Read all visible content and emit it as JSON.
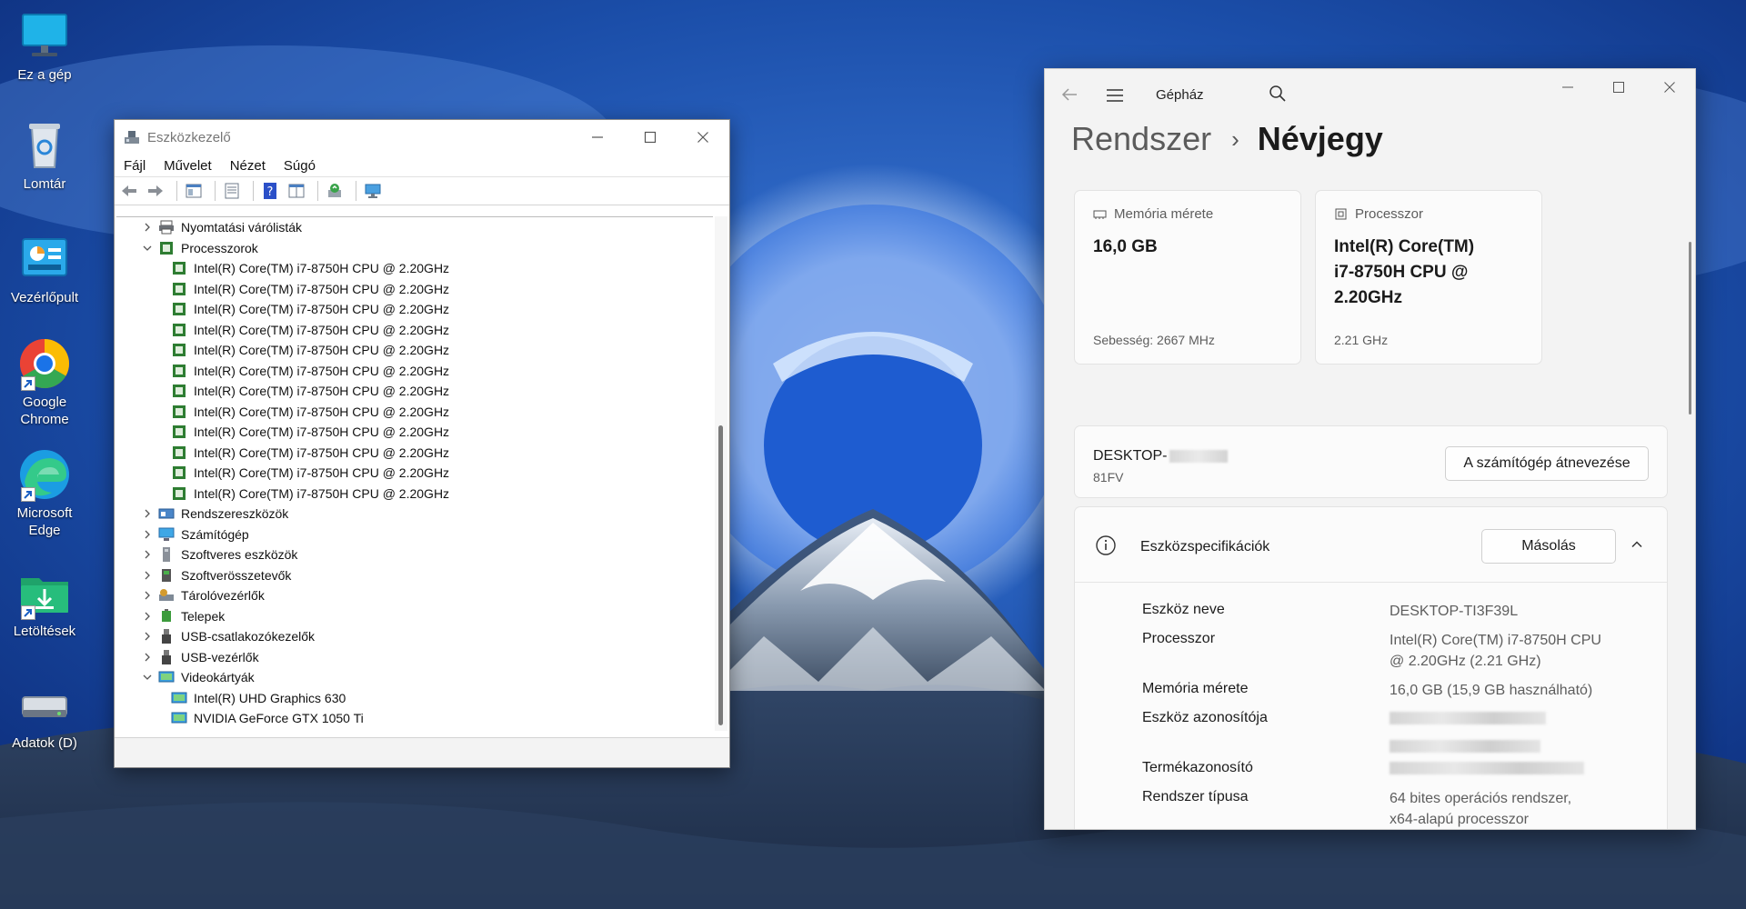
{
  "desktop": {
    "icons": [
      {
        "label": "Ez a gép"
      },
      {
        "label": "Lomtár"
      },
      {
        "label": "Vezérlőpult"
      },
      {
        "label": "Google Chrome"
      },
      {
        "label": "Microsoft Edge"
      },
      {
        "label": "Letöltések"
      },
      {
        "label": "Adatok (D)"
      }
    ]
  },
  "device_manager": {
    "title": "Eszközkezelő",
    "menu": [
      "Fájl",
      "Művelet",
      "Nézet",
      "Súgó"
    ],
    "tree": [
      {
        "label": "Nyomtatási várólisták",
        "expanded": false,
        "icon": "printer-icon"
      },
      {
        "label": "Processzorok",
        "expanded": true,
        "icon": "processor-icon"
      },
      {
        "label": "Intel(R) Core(TM) i7-8750H CPU @ 2.20GHz",
        "child": true,
        "icon": "processor-icon"
      },
      {
        "label": "Intel(R) Core(TM) i7-8750H CPU @ 2.20GHz",
        "child": true,
        "icon": "processor-icon"
      },
      {
        "label": "Intel(R) Core(TM) i7-8750H CPU @ 2.20GHz",
        "child": true,
        "icon": "processor-icon"
      },
      {
        "label": "Intel(R) Core(TM) i7-8750H CPU @ 2.20GHz",
        "child": true,
        "icon": "processor-icon"
      },
      {
        "label": "Intel(R) Core(TM) i7-8750H CPU @ 2.20GHz",
        "child": true,
        "icon": "processor-icon"
      },
      {
        "label": "Intel(R) Core(TM) i7-8750H CPU @ 2.20GHz",
        "child": true,
        "icon": "processor-icon"
      },
      {
        "label": "Intel(R) Core(TM) i7-8750H CPU @ 2.20GHz",
        "child": true,
        "icon": "processor-icon"
      },
      {
        "label": "Intel(R) Core(TM) i7-8750H CPU @ 2.20GHz",
        "child": true,
        "icon": "processor-icon"
      },
      {
        "label": "Intel(R) Core(TM) i7-8750H CPU @ 2.20GHz",
        "child": true,
        "icon": "processor-icon"
      },
      {
        "label": "Intel(R) Core(TM) i7-8750H CPU @ 2.20GHz",
        "child": true,
        "icon": "processor-icon"
      },
      {
        "label": "Intel(R) Core(TM) i7-8750H CPU @ 2.20GHz",
        "child": true,
        "icon": "processor-icon"
      },
      {
        "label": "Intel(R) Core(TM) i7-8750H CPU @ 2.20GHz",
        "child": true,
        "icon": "processor-icon"
      },
      {
        "label": "Rendszereszközök",
        "expanded": false,
        "icon": "system-devices-icon"
      },
      {
        "label": "Számítógép",
        "expanded": false,
        "icon": "computer-icon"
      },
      {
        "label": "Szoftveres eszközök",
        "expanded": false,
        "icon": "software-device-icon"
      },
      {
        "label": "Szoftverösszetevők",
        "expanded": false,
        "icon": "software-component-icon"
      },
      {
        "label": "Tárolóvezérlők",
        "expanded": false,
        "icon": "storage-controller-icon"
      },
      {
        "label": "Telepek",
        "expanded": false,
        "icon": "battery-icon"
      },
      {
        "label": "USB-csatlakozókezelők",
        "expanded": false,
        "icon": "usb-icon"
      },
      {
        "label": "USB-vezérlők",
        "expanded": false,
        "icon": "usb-icon"
      },
      {
        "label": "Videokártyák",
        "expanded": true,
        "icon": "display-adapter-icon"
      },
      {
        "label": "Intel(R) UHD Graphics 630",
        "child": true,
        "icon": "display-adapter-icon"
      },
      {
        "label": "NVIDIA GeForce GTX 1050 Ti",
        "child": true,
        "icon": "display-adapter-icon"
      }
    ]
  },
  "settings": {
    "app_title": "Gépház",
    "breadcrumb_parent": "Rendszer",
    "breadcrumb_sep": "›",
    "breadcrumb_current": "Névjegy",
    "memory_card": {
      "label": "Memória mérete",
      "value": "16,0 GB",
      "sub": "Sebesség: 2667 MHz"
    },
    "cpu_card": {
      "label": "Processzor",
      "value_lines": [
        "Intel(R) Core(TM)",
        "i7-8750H CPU @",
        "2.20GHz"
      ],
      "sub": "2.21 GHz"
    },
    "pc": {
      "name": "DESKTOP-",
      "model": "81FV",
      "rename_button": "A számítógép átnevezése"
    },
    "specs": {
      "title": "Eszközspecifikációk",
      "copy_button": "Másolás",
      "rows": [
        {
          "label": "Eszköz neve",
          "value": "DESKTOP-TI3F39L"
        },
        {
          "label": "Processzor",
          "value": "Intel(R) Core(TM) i7-8750H CPU",
          "value2": "@ 2.20GHz (2.21 GHz)"
        },
        {
          "label": "Memória mérete",
          "value": "16,0 GB (15,9 GB használható)"
        },
        {
          "label": "Eszköz azonosítója",
          "value": "",
          "redacted": true
        },
        {
          "label": "Termékazonosító",
          "value": "",
          "redacted": true
        },
        {
          "label": "Rendszer típusa",
          "value": "64 bites operációs rendszer,",
          "value2": "x64-alapú processzor"
        }
      ]
    }
  },
  "colors": {
    "accent": "#0067c0",
    "chrome_red": "#ea4335",
    "chrome_green": "#34a853",
    "chrome_yellow": "#fbbc04",
    "edge_blue": "#1b9de2"
  }
}
